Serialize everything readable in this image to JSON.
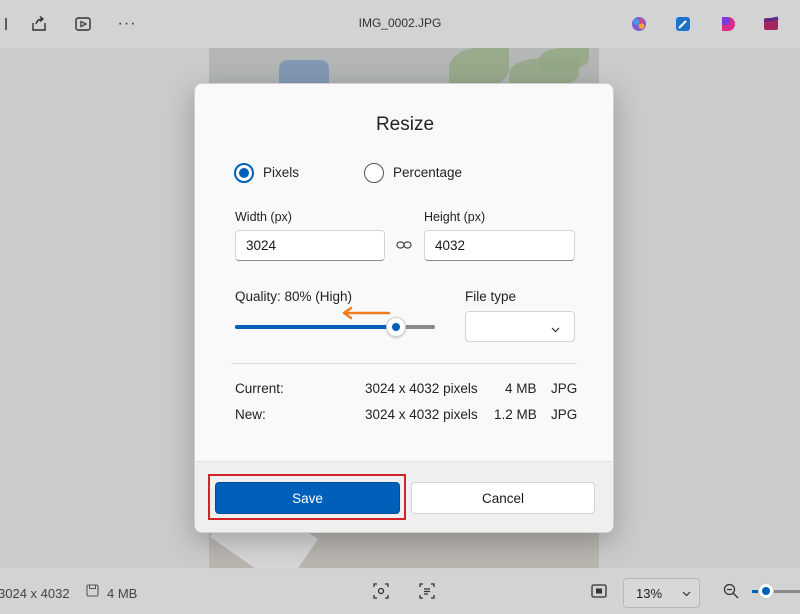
{
  "topbar": {
    "filename": "IMG_0002.JPG",
    "icons": [
      "share-icon",
      "slideshow-icon",
      "more-icon",
      "copilot-icon",
      "edit-icon",
      "clipchamp-icon",
      "designer-icon"
    ],
    "more_label": "···"
  },
  "dialog": {
    "title": "Resize",
    "mode_options": [
      "Pixels",
      "Percentage"
    ],
    "selected_mode": "Pixels",
    "width_label": "Width  (px)",
    "width_value": "3024",
    "height_label": "Height  (px)",
    "height_value": "4032",
    "quality_label": "Quality: 80% (High)",
    "quality_value": 0.8,
    "file_type_label": "File type",
    "file_type_value": "",
    "current": {
      "label": "Current:",
      "pixels": "3024 x 4032 pixels",
      "size": "4 MB",
      "format": "JPG"
    },
    "new": {
      "label": "New:",
      "pixels": "3024 x 4032 pixels",
      "size": "1.2 MB",
      "format": "JPG"
    },
    "save_label": "Save",
    "cancel_label": "Cancel"
  },
  "bottombar": {
    "dimensions": "3024 x 4032",
    "filesize": "4 MB",
    "zoom": "13%"
  },
  "colors": {
    "accent": "#005fb8",
    "highlight": "#d3232a",
    "annotation_arrow": "#f07c22"
  }
}
